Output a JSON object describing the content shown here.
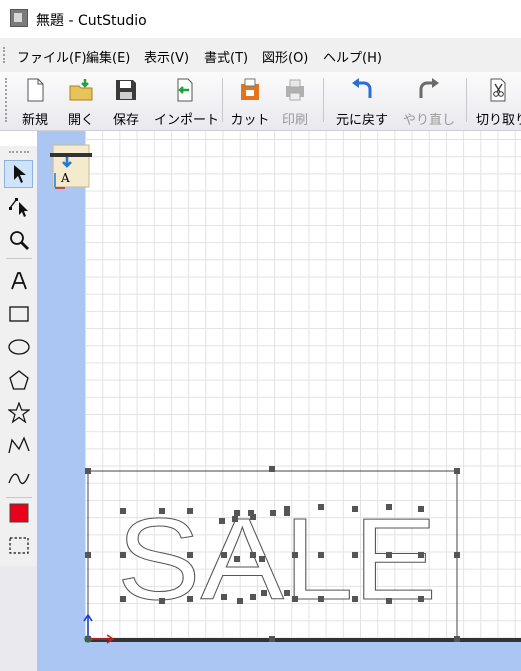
{
  "window": {
    "title": "無題 - CutStudio"
  },
  "menu": [
    {
      "label": "ファイル(F)"
    },
    {
      "label": "編集(E)"
    },
    {
      "label": "表示(V)"
    },
    {
      "label": "書式(T)"
    },
    {
      "label": "図形(O)"
    },
    {
      "label": "ヘルプ(H)"
    }
  ],
  "toolbar": [
    {
      "label": "新規",
      "icon": "new-document-icon",
      "enabled": true
    },
    {
      "label": "開く",
      "icon": "open-folder-icon",
      "enabled": true
    },
    {
      "label": "保存",
      "icon": "save-disk-icon",
      "enabled": true
    },
    {
      "label": "インポート",
      "icon": "import-icon",
      "enabled": true
    },
    {
      "label": "カット",
      "icon": "cut-icon",
      "enabled": true
    },
    {
      "label": "印刷",
      "icon": "print-icon",
      "enabled": false
    },
    {
      "label": "元に戻す",
      "icon": "undo-icon",
      "enabled": true
    },
    {
      "label": "やり直し",
      "icon": "redo-icon",
      "enabled": false
    },
    {
      "label": "切り取り",
      "icon": "cut-scissors-icon",
      "enabled": true
    }
  ],
  "tools": [
    {
      "name": "select-tool",
      "icon": "arrow-pointer-icon",
      "selected": true
    },
    {
      "name": "node-edit-tool",
      "icon": "node-edit-icon"
    },
    {
      "name": "zoom-tool",
      "icon": "magnifier-icon"
    },
    {
      "name": "text-tool",
      "icon": "letter-a-icon"
    },
    {
      "name": "rectangle-tool",
      "icon": "rectangle-icon"
    },
    {
      "name": "ellipse-tool",
      "icon": "ellipse-icon"
    },
    {
      "name": "polygon-tool",
      "icon": "pentagon-icon"
    },
    {
      "name": "star-tool",
      "icon": "star-icon"
    },
    {
      "name": "polyline-tool",
      "icon": "polyline-icon"
    },
    {
      "name": "curve-tool",
      "icon": "curve-icon"
    },
    {
      "name": "fill-color-tool",
      "icon": "red-swatch-icon",
      "color": "#e8001c"
    },
    {
      "name": "marquee-tool",
      "icon": "dashed-rectangle-icon"
    }
  ],
  "canvas": {
    "text_object": "SALE",
    "media_widget_label": "A",
    "colors": {
      "sheet_margin": "#abc6f3",
      "grid": "#e2e2e2",
      "handle": "#555555",
      "swatch": "#e8001c"
    }
  }
}
